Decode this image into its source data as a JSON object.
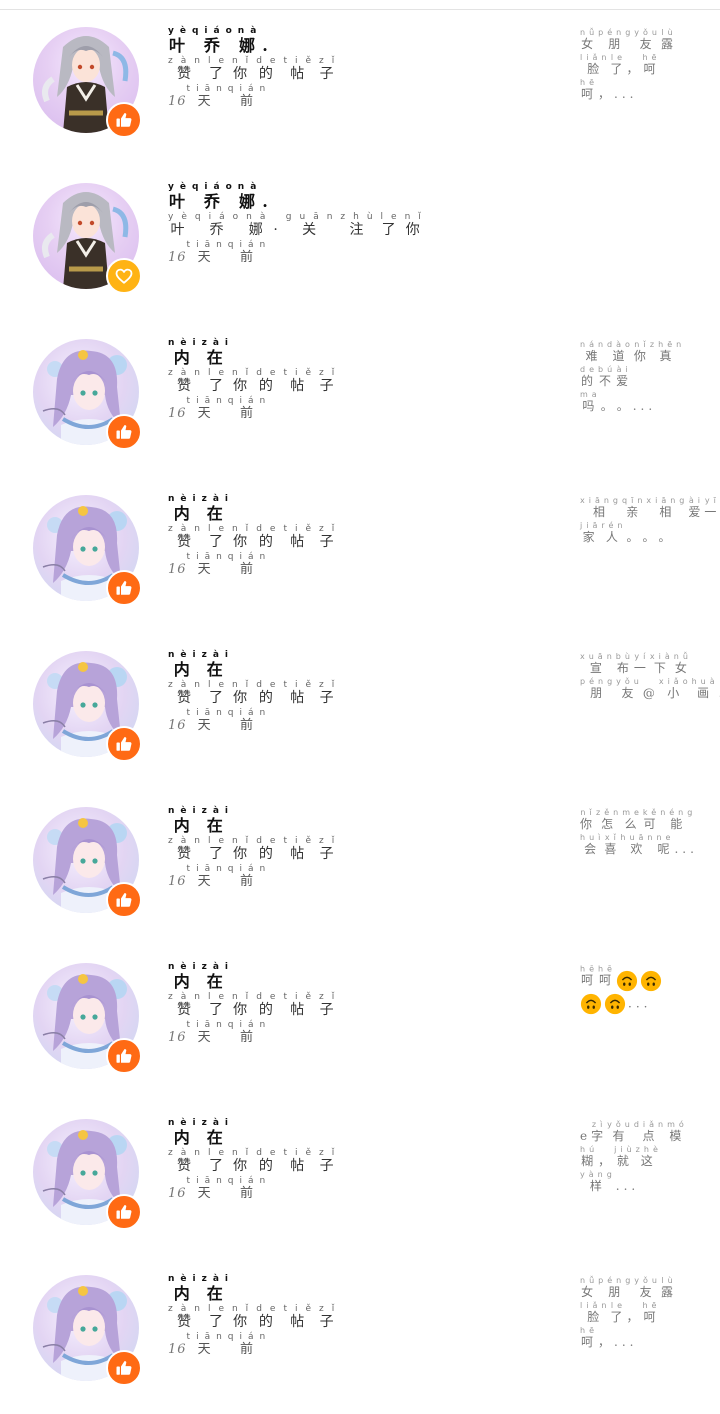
{
  "notifications": [
    {
      "avatar": "anime-girl-1",
      "badge": "thumbs-up",
      "name": [
        {
          "c": "叶",
          "p": "yè"
        },
        {
          "c": "乔",
          "p": "qiáo"
        },
        {
          "c": "娜",
          "p": "nà"
        },
        {
          "c": ".",
          "p": ""
        }
      ],
      "action": [
        {
          "c": "赞",
          "p": "zàn"
        },
        {
          "c": "了",
          "p": "le"
        },
        {
          "c": "你",
          "p": "nǐ"
        },
        {
          "c": "的",
          "p": "de"
        },
        {
          "c": "帖",
          "p": "tiě"
        },
        {
          "c": "子",
          "p": "zǐ"
        }
      ],
      "time_num": "16",
      "time": [
        {
          "c": "天",
          "p": "tiān"
        },
        {
          "c": "前",
          "p": "qián"
        }
      ],
      "preview": [
        [
          {
            "c": "女",
            "p": "nǚ"
          },
          {
            "c": "朋",
            "p": "péng"
          },
          {
            "c": "友",
            "p": "yǒu"
          },
          {
            "c": "露",
            "p": "lù"
          }
        ],
        [
          {
            "c": "脸",
            "p": "liǎn"
          },
          {
            "c": "了",
            "p": "le"
          },
          {
            "c": "，",
            "p": ""
          },
          {
            "c": "呵",
            "p": "hē"
          }
        ],
        [
          {
            "c": "呵",
            "p": "hē"
          },
          {
            "c": "，",
            "p": ""
          },
          {
            "c": "...",
            "p": ""
          }
        ]
      ]
    },
    {
      "avatar": "anime-girl-1",
      "badge": "heart",
      "name": [
        {
          "c": "叶",
          "p": "yè"
        },
        {
          "c": "乔",
          "p": "qiáo"
        },
        {
          "c": "娜",
          "p": "nà"
        },
        {
          "c": ".",
          "p": ""
        }
      ],
      "action": [
        {
          "c": "叶",
          "p": "yè"
        },
        {
          "c": "乔",
          "p": "qiáo"
        },
        {
          "c": "娜",
          "p": "nà"
        },
        {
          "c": "·",
          "p": ""
        },
        {
          "c": "关",
          "p": "guān"
        },
        {
          "c": "注",
          "p": "zhù"
        },
        {
          "c": "了",
          "p": "le"
        },
        {
          "c": "你",
          "p": "nǐ"
        }
      ],
      "time_num": "16",
      "time": [
        {
          "c": "天",
          "p": "tiān"
        },
        {
          "c": "前",
          "p": "qián"
        }
      ],
      "preview": []
    },
    {
      "avatar": "anime-girl-2",
      "badge": "thumbs-up",
      "name": [
        {
          "c": "内",
          "p": "nèi"
        },
        {
          "c": "在",
          "p": "zài"
        }
      ],
      "action": [
        {
          "c": "赞",
          "p": "zàn"
        },
        {
          "c": "了",
          "p": "le"
        },
        {
          "c": "你",
          "p": "nǐ"
        },
        {
          "c": "的",
          "p": "de"
        },
        {
          "c": "帖",
          "p": "tiě"
        },
        {
          "c": "子",
          "p": "zǐ"
        }
      ],
      "time_num": "16",
      "time": [
        {
          "c": "天",
          "p": "tiān"
        },
        {
          "c": "前",
          "p": "qián"
        }
      ],
      "preview": [
        [
          {
            "c": "难",
            "p": "nán"
          },
          {
            "c": "道",
            "p": "dào"
          },
          {
            "c": "你",
            "p": "nǐ"
          },
          {
            "c": "真",
            "p": "zhēn"
          }
        ],
        [
          {
            "c": "的",
            "p": "de"
          },
          {
            "c": "不",
            "p": "bú"
          },
          {
            "c": "爱",
            "p": "ài"
          }
        ],
        [
          {
            "c": "吗",
            "p": "ma"
          },
          {
            "c": "。",
            "p": ""
          },
          {
            "c": "。",
            "p": ""
          },
          {
            "c": "...",
            "p": ""
          }
        ]
      ]
    },
    {
      "avatar": "anime-girl-2",
      "badge": "thumbs-up",
      "name": [
        {
          "c": "内",
          "p": "nèi"
        },
        {
          "c": "在",
          "p": "zài"
        }
      ],
      "action": [
        {
          "c": "赞",
          "p": "zàn"
        },
        {
          "c": "了",
          "p": "le"
        },
        {
          "c": "你",
          "p": "nǐ"
        },
        {
          "c": "的",
          "p": "de"
        },
        {
          "c": "帖",
          "p": "tiě"
        },
        {
          "c": "子",
          "p": "zǐ"
        }
      ],
      "time_num": "16",
      "time": [
        {
          "c": "天",
          "p": "tiān"
        },
        {
          "c": "前",
          "p": "qián"
        }
      ],
      "preview": [
        [
          {
            "c": "相",
            "p": "xiāng"
          },
          {
            "c": "亲",
            "p": "qīn"
          },
          {
            "c": "相",
            "p": "xiāng"
          },
          {
            "c": "爱",
            "p": "ài"
          },
          {
            "c": "一",
            "p": "yī"
          }
        ],
        [
          {
            "c": "家",
            "p": "jiā"
          },
          {
            "c": "人",
            "p": "rén"
          },
          {
            "c": "。",
            "p": ""
          },
          {
            "c": "。",
            "p": ""
          },
          {
            "c": "。",
            "p": ""
          }
        ]
      ]
    },
    {
      "avatar": "anime-girl-2",
      "badge": "thumbs-up",
      "name": [
        {
          "c": "内",
          "p": "nèi"
        },
        {
          "c": "在",
          "p": "zài"
        }
      ],
      "action": [
        {
          "c": "赞",
          "p": "zàn"
        },
        {
          "c": "了",
          "p": "le"
        },
        {
          "c": "你",
          "p": "nǐ"
        },
        {
          "c": "的",
          "p": "de"
        },
        {
          "c": "帖",
          "p": "tiě"
        },
        {
          "c": "子",
          "p": "zǐ"
        }
      ],
      "time_num": "16",
      "time": [
        {
          "c": "天",
          "p": "tiān"
        },
        {
          "c": "前",
          "p": "qián"
        }
      ],
      "preview": [
        [
          {
            "c": "宣",
            "p": "xuān"
          },
          {
            "c": "布",
            "p": "bù"
          },
          {
            "c": "一",
            "p": "yí"
          },
          {
            "c": "下",
            "p": "xià"
          },
          {
            "c": "女",
            "p": "nǚ"
          }
        ],
        [
          {
            "c": "朋",
            "p": "péng"
          },
          {
            "c": "友",
            "p": "yǒu"
          },
          {
            "c": "@",
            "p": ""
          },
          {
            "c": "小",
            "p": "xiǎo"
          },
          {
            "c": "画",
            "p": "huà"
          },
          {
            "c": "...",
            "p": ""
          }
        ]
      ]
    },
    {
      "avatar": "anime-girl-2",
      "badge": "thumbs-up",
      "name": [
        {
          "c": "内",
          "p": "nèi"
        },
        {
          "c": "在",
          "p": "zài"
        }
      ],
      "action": [
        {
          "c": "赞",
          "p": "zàn"
        },
        {
          "c": "了",
          "p": "le"
        },
        {
          "c": "你",
          "p": "nǐ"
        },
        {
          "c": "的",
          "p": "de"
        },
        {
          "c": "帖",
          "p": "tiě"
        },
        {
          "c": "子",
          "p": "zǐ"
        }
      ],
      "time_num": "16",
      "time": [
        {
          "c": "天",
          "p": "tiān"
        },
        {
          "c": "前",
          "p": "qián"
        }
      ],
      "preview": [
        [
          {
            "c": "你",
            "p": "nǐ"
          },
          {
            "c": "怎",
            "p": "zěn"
          },
          {
            "c": "么",
            "p": "me"
          },
          {
            "c": "可",
            "p": "kě"
          },
          {
            "c": "能",
            "p": "néng"
          }
        ],
        [
          {
            "c": "会",
            "p": "huì"
          },
          {
            "c": "喜",
            "p": "xǐ"
          },
          {
            "c": "欢",
            "p": "huān"
          },
          {
            "c": "呢",
            "p": "ne"
          },
          {
            "c": "...",
            "p": ""
          }
        ]
      ]
    },
    {
      "avatar": "anime-girl-2",
      "badge": "thumbs-up",
      "name": [
        {
          "c": "内",
          "p": "nèi"
        },
        {
          "c": "在",
          "p": "zài"
        }
      ],
      "action": [
        {
          "c": "赞",
          "p": "zàn"
        },
        {
          "c": "了",
          "p": "le"
        },
        {
          "c": "你",
          "p": "nǐ"
        },
        {
          "c": "的",
          "p": "de"
        },
        {
          "c": "帖",
          "p": "tiě"
        },
        {
          "c": "子",
          "p": "zǐ"
        }
      ],
      "time_num": "16",
      "time": [
        {
          "c": "天",
          "p": "tiān"
        },
        {
          "c": "前",
          "p": "qián"
        }
      ],
      "preview_emoji": {
        "text": [
          {
            "c": "呵",
            "p": "hē"
          },
          {
            "c": "呵",
            "p": "hē"
          }
        ],
        "line1_icons": 2,
        "line2_icons": 2,
        "ellipsis": "..."
      }
    },
    {
      "avatar": "anime-girl-2",
      "badge": "thumbs-up",
      "name": [
        {
          "c": "内",
          "p": "nèi"
        },
        {
          "c": "在",
          "p": "zài"
        }
      ],
      "action": [
        {
          "c": "赞",
          "p": "zàn"
        },
        {
          "c": "了",
          "p": "le"
        },
        {
          "c": "你",
          "p": "nǐ"
        },
        {
          "c": "的",
          "p": "de"
        },
        {
          "c": "帖",
          "p": "tiě"
        },
        {
          "c": "子",
          "p": "zǐ"
        }
      ],
      "time_num": "16",
      "time": [
        {
          "c": "天",
          "p": "tiān"
        },
        {
          "c": "前",
          "p": "qián"
        }
      ],
      "preview": [
        [
          {
            "c": "e",
            "p": ""
          },
          {
            "c": "字",
            "p": "zì"
          },
          {
            "c": "有",
            "p": "yǒu"
          },
          {
            "c": "点",
            "p": "diǎn"
          },
          {
            "c": "模",
            "p": "mó"
          }
        ],
        [
          {
            "c": "糊",
            "p": "hú"
          },
          {
            "c": "，",
            "p": ""
          },
          {
            "c": "就",
            "p": "jiù"
          },
          {
            "c": "这",
            "p": "zhè"
          }
        ],
        [
          {
            "c": "样",
            "p": "yàng"
          },
          {
            "c": "...",
            "p": ""
          }
        ]
      ]
    },
    {
      "avatar": "anime-girl-2",
      "badge": "thumbs-up",
      "name": [
        {
          "c": "内",
          "p": "nèi"
        },
        {
          "c": "在",
          "p": "zài"
        }
      ],
      "action": [
        {
          "c": "赞",
          "p": "zàn"
        },
        {
          "c": "了",
          "p": "le"
        },
        {
          "c": "你",
          "p": "nǐ"
        },
        {
          "c": "的",
          "p": "de"
        },
        {
          "c": "帖",
          "p": "tiě"
        },
        {
          "c": "子",
          "p": "zǐ"
        }
      ],
      "time_num": "16",
      "time": [
        {
          "c": "天",
          "p": "tiān"
        },
        {
          "c": "前",
          "p": "qián"
        }
      ],
      "preview": [
        [
          {
            "c": "女",
            "p": "nǚ"
          },
          {
            "c": "朋",
            "p": "péng"
          },
          {
            "c": "友",
            "p": "yǒu"
          },
          {
            "c": "露",
            "p": "lù"
          }
        ],
        [
          {
            "c": "脸",
            "p": "liǎn"
          },
          {
            "c": "了",
            "p": "le"
          },
          {
            "c": "，",
            "p": ""
          },
          {
            "c": "呵",
            "p": "hē"
          }
        ],
        [
          {
            "c": "呵",
            "p": "hē"
          },
          {
            "c": "，",
            "p": ""
          },
          {
            "c": "...",
            "p": ""
          }
        ]
      ]
    }
  ],
  "colors": {
    "like_badge": "#ff6a14",
    "heart_badge": "#ffb314",
    "emoji": "#ffb400"
  }
}
